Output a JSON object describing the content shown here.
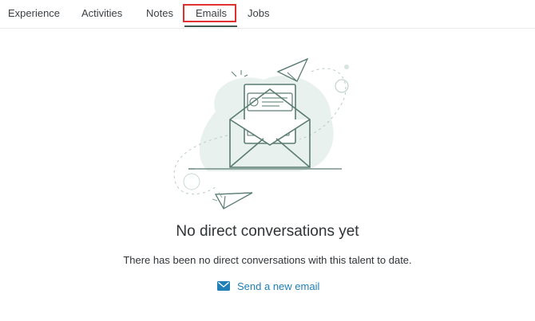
{
  "tabs": [
    {
      "label": "Experience"
    },
    {
      "label": "Activities"
    },
    {
      "label": "Notes"
    },
    {
      "label": "Emails"
    },
    {
      "label": "Jobs"
    }
  ],
  "active_tab": "Emails",
  "empty_state": {
    "title": "No direct conversations yet",
    "description": "There has been no direct conversations with this talent to date.",
    "action_label": "Send a new email",
    "action_icon": "envelope-icon",
    "illustration_icon": "open-envelope-illustration"
  },
  "colors": {
    "accent": "#1f7fb6",
    "illustration_stroke": "#5a7d70",
    "illustration_fill": "#e8f1ee",
    "highlight": "#e0312f"
  }
}
